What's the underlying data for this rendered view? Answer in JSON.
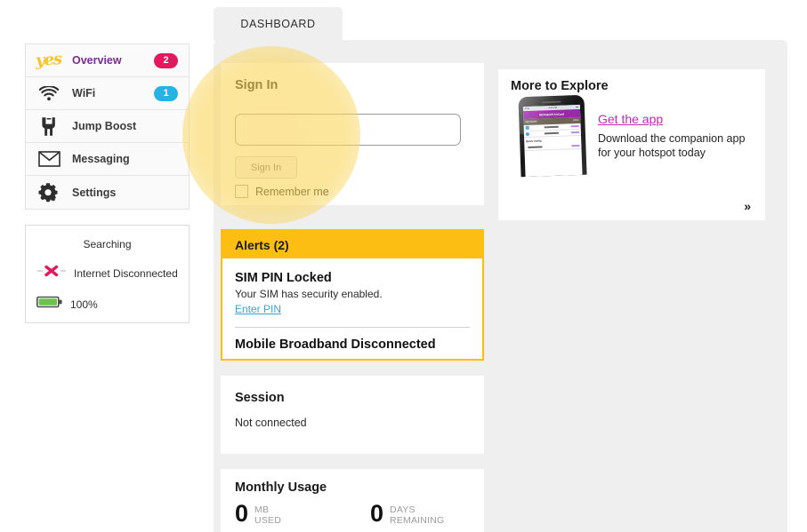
{
  "tab": {
    "label": "DASHBOARD"
  },
  "brand": {
    "logo_text": "yes"
  },
  "sidebar": {
    "items": [
      {
        "label": "Overview",
        "icon": "yes-logo-icon",
        "badge": "2"
      },
      {
        "label": "WiFi",
        "icon": "wifi-icon",
        "badge": "1"
      },
      {
        "label": "Jump Boost",
        "icon": "jump-boost-icon",
        "badge": ""
      },
      {
        "label": "Messaging",
        "icon": "envelope-icon",
        "badge": ""
      },
      {
        "label": "Settings",
        "icon": "gear-icon",
        "badge": ""
      }
    ]
  },
  "status": {
    "searching": "Searching",
    "internet": "Internet Disconnected",
    "battery": "100%"
  },
  "signin": {
    "title": "Sign In",
    "input_value": "",
    "input_placeholder": "",
    "button_label": "Sign In",
    "remember_label": "Remember me"
  },
  "alerts": {
    "header": "Alerts (2)",
    "items": [
      {
        "title": "SIM PIN Locked",
        "description": "Your SIM has security enabled.",
        "link": "Enter PIN"
      },
      {
        "title": "Mobile Broadband Disconnected",
        "description": "",
        "link": ""
      }
    ]
  },
  "session": {
    "title": "Session",
    "text": "Not connected"
  },
  "usage": {
    "title": "Monthly Usage",
    "stats": [
      {
        "number": "0",
        "unit_line1": "MB",
        "unit_line2": "USED"
      },
      {
        "number": "0",
        "unit_line1": "DAYS",
        "unit_line2": "REMAINING"
      }
    ]
  },
  "explore": {
    "title": "More to Explore",
    "link_text": "Get the app",
    "description": "Download the companion app for your hotspot today",
    "next_icon": "»",
    "phone_mockup": {
      "brand": "NETGEAR AirCard",
      "brand_button": "Connect",
      "status_left": "iPad",
      "status_center": "4:45 PM",
      "section": "NETWORK",
      "section_right": "100%",
      "rows": [
        "Monthly Usage",
        "Session Usage"
      ],
      "quick_config": "Quick Config"
    }
  },
  "colors": {
    "badge_pink": "#e3195e",
    "badge_blue": "#26b2e4",
    "alert_yellow": "#fcbe12",
    "link_blue": "#3ba2dd",
    "magenta": "#c42bb3",
    "logo_yellow": "#fac524",
    "overview_purple": "#7b2d8e",
    "battery_green": "#6cc24a",
    "spotlight": "#fad55b"
  }
}
